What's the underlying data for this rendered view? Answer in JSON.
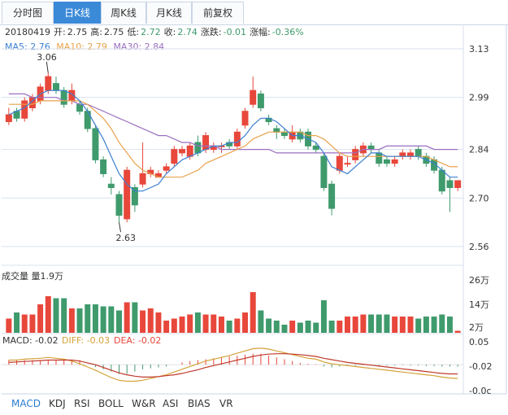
{
  "tabs": [
    {
      "label": "分时图",
      "active": false
    },
    {
      "label": "日K线",
      "active": true
    },
    {
      "label": "周K线",
      "active": false
    },
    {
      "label": "月K线",
      "active": false
    },
    {
      "label": "前复权",
      "active": false
    }
  ],
  "info": {
    "date": "20180419",
    "open_label": "开:",
    "open": "2.75",
    "high_label": "高:",
    "high": "2.75",
    "low_label": "低:",
    "low": "2.72",
    "close_label": "收:",
    "close": "2.74",
    "change_label": "涨跌:",
    "change": "-0.01",
    "pct_label": "涨幅:",
    "pct": "-0.36%"
  },
  "ma_legend": {
    "ma5": "MA5: 2.76",
    "ma10": "MA10: 2.79",
    "ma30": "MA30: 2.84"
  },
  "price_axis": [
    "3.13",
    "2.99",
    "2.84",
    "2.70",
    "2.56"
  ],
  "price_annotations": {
    "high": "3.06",
    "low": "2.63"
  },
  "volume_section": {
    "title": "成交量 量1.9万",
    "axis": [
      "26万",
      "14万",
      "2万"
    ]
  },
  "macd_section": {
    "macd": "MACD: -0.02",
    "diff": "DIFF: -0.03",
    "dea": "DEA: -0.02",
    "axis": [
      "0.05",
      "-0.02",
      "-0.0c"
    ]
  },
  "bottom_tabs": [
    {
      "label": "MACD",
      "active": true
    },
    {
      "label": "KDJ",
      "active": false
    },
    {
      "label": "RSI",
      "active": false
    },
    {
      "label": "BOLL",
      "active": false
    },
    {
      "label": "W&R",
      "active": false
    },
    {
      "label": "ASI",
      "active": false
    },
    {
      "label": "BIAS",
      "active": false
    },
    {
      "label": "VR",
      "active": false
    }
  ],
  "colors": {
    "up": "#e8473b",
    "down": "#3f9a6c",
    "ma5": "#3b7fd1",
    "ma10": "#e9a24b",
    "ma30": "#9b6fc1",
    "active_tab": "#3b8ad8",
    "grid": "#d9e2ee"
  },
  "chart_data": {
    "type": "candlestick",
    "price_ylim": [
      2.56,
      3.13
    ],
    "candles": [
      {
        "o": 2.92,
        "c": 2.94,
        "h": 2.96,
        "l": 2.91
      },
      {
        "o": 2.95,
        "c": 2.93,
        "h": 2.96,
        "l": 2.92
      },
      {
        "o": 2.93,
        "c": 2.98,
        "h": 2.99,
        "l": 2.92
      },
      {
        "o": 2.96,
        "c": 2.99,
        "h": 3.0,
        "l": 2.95
      },
      {
        "o": 2.98,
        "c": 3.02,
        "h": 3.03,
        "l": 2.97
      },
      {
        "o": 3.01,
        "c": 3.05,
        "h": 3.06,
        "l": 3.0
      },
      {
        "o": 3.03,
        "c": 3.01,
        "h": 3.05,
        "l": 3.0
      },
      {
        "o": 3.01,
        "c": 2.97,
        "h": 3.02,
        "l": 2.96
      },
      {
        "o": 2.98,
        "c": 3.01,
        "h": 3.03,
        "l": 2.97
      },
      {
        "o": 2.97,
        "c": 2.95,
        "h": 2.98,
        "l": 2.94
      },
      {
        "o": 2.95,
        "c": 2.9,
        "h": 2.96,
        "l": 2.89
      },
      {
        "o": 2.9,
        "c": 2.81,
        "h": 2.91,
        "l": 2.8
      },
      {
        "o": 2.81,
        "c": 2.77,
        "h": 2.82,
        "l": 2.76
      },
      {
        "o": 2.74,
        "c": 2.73,
        "h": 2.76,
        "l": 2.71
      },
      {
        "o": 2.71,
        "c": 2.65,
        "h": 2.72,
        "l": 2.63
      },
      {
        "o": 2.64,
        "c": 2.78,
        "h": 2.79,
        "l": 2.63
      },
      {
        "o": 2.73,
        "c": 2.68,
        "h": 2.74,
        "l": 2.66
      },
      {
        "o": 2.74,
        "c": 2.77,
        "h": 2.86,
        "l": 2.73
      },
      {
        "o": 2.77,
        "c": 2.78,
        "h": 2.79,
        "l": 2.76
      },
      {
        "o": 2.76,
        "c": 2.77,
        "h": 2.78,
        "l": 2.76
      },
      {
        "o": 2.78,
        "c": 2.79,
        "h": 2.8,
        "l": 2.77
      },
      {
        "o": 2.8,
        "c": 2.84,
        "h": 2.85,
        "l": 2.79
      },
      {
        "o": 2.83,
        "c": 2.84,
        "h": 2.85,
        "l": 2.82
      },
      {
        "o": 2.82,
        "c": 2.85,
        "h": 2.86,
        "l": 2.81
      },
      {
        "o": 2.86,
        "c": 2.83,
        "h": 2.88,
        "l": 2.82
      },
      {
        "o": 2.84,
        "c": 2.88,
        "h": 2.89,
        "l": 2.83
      },
      {
        "o": 2.84,
        "c": 2.85,
        "h": 2.86,
        "l": 2.83
      },
      {
        "o": 2.85,
        "c": 2.85,
        "h": 2.86,
        "l": 2.83
      },
      {
        "o": 2.86,
        "c": 2.85,
        "h": 2.87,
        "l": 2.84
      },
      {
        "o": 2.85,
        "c": 2.89,
        "h": 2.9,
        "l": 2.84
      },
      {
        "o": 2.91,
        "c": 2.95,
        "h": 2.96,
        "l": 2.9
      },
      {
        "o": 2.97,
        "c": 3.01,
        "h": 3.05,
        "l": 2.96
      },
      {
        "o": 3.0,
        "c": 2.96,
        "h": 3.01,
        "l": 2.95
      },
      {
        "o": 2.93,
        "c": 2.92,
        "h": 2.94,
        "l": 2.91
      },
      {
        "o": 2.9,
        "c": 2.89,
        "h": 2.91,
        "l": 2.87
      },
      {
        "o": 2.89,
        "c": 2.88,
        "h": 2.9,
        "l": 2.87
      },
      {
        "o": 2.87,
        "c": 2.89,
        "h": 2.91,
        "l": 2.86
      },
      {
        "o": 2.89,
        "c": 2.87,
        "h": 2.9,
        "l": 2.86
      },
      {
        "o": 2.89,
        "c": 2.85,
        "h": 2.9,
        "l": 2.84
      },
      {
        "o": 2.85,
        "c": 2.84,
        "h": 2.86,
        "l": 2.83
      },
      {
        "o": 2.82,
        "c": 2.73,
        "h": 2.83,
        "l": 2.72
      },
      {
        "o": 2.74,
        "c": 2.67,
        "h": 2.75,
        "l": 2.65
      },
      {
        "o": 2.78,
        "c": 2.82,
        "h": 2.83,
        "l": 2.77
      },
      {
        "o": 2.8,
        "c": 2.8,
        "h": 2.82,
        "l": 2.79
      },
      {
        "o": 2.81,
        "c": 2.84,
        "h": 2.85,
        "l": 2.8
      },
      {
        "o": 2.83,
        "c": 2.85,
        "h": 2.86,
        "l": 2.82
      },
      {
        "o": 2.85,
        "c": 2.84,
        "h": 2.86,
        "l": 2.83
      },
      {
        "o": 2.83,
        "c": 2.8,
        "h": 2.84,
        "l": 2.79
      },
      {
        "o": 2.81,
        "c": 2.8,
        "h": 2.82,
        "l": 2.79
      },
      {
        "o": 2.8,
        "c": 2.81,
        "h": 2.82,
        "l": 2.79
      },
      {
        "o": 2.82,
        "c": 2.83,
        "h": 2.84,
        "l": 2.81
      },
      {
        "o": 2.82,
        "c": 2.83,
        "h": 2.84,
        "l": 2.81
      },
      {
        "o": 2.84,
        "c": 2.82,
        "h": 2.85,
        "l": 2.81
      },
      {
        "o": 2.82,
        "c": 2.8,
        "h": 2.83,
        "l": 2.79
      },
      {
        "o": 2.81,
        "c": 2.78,
        "h": 2.82,
        "l": 2.77
      },
      {
        "o": 2.78,
        "c": 2.72,
        "h": 2.79,
        "l": 2.71
      },
      {
        "o": 2.75,
        "c": 2.73,
        "h": 2.76,
        "l": 2.66
      },
      {
        "o": 2.73,
        "c": 2.75,
        "h": 2.75,
        "l": 2.72
      }
    ],
    "ma5": [
      2.94,
      2.95,
      2.96,
      2.98,
      3.0,
      3.01,
      3.01,
      3.01,
      3.0,
      2.98,
      2.95,
      2.91,
      2.87,
      2.82,
      2.77,
      2.74,
      2.72,
      2.72,
      2.73,
      2.74,
      2.77,
      2.79,
      2.81,
      2.82,
      2.83,
      2.84,
      2.85,
      2.85,
      2.86,
      2.86,
      2.88,
      2.91,
      2.93,
      2.93,
      2.92,
      2.9,
      2.88,
      2.88,
      2.87,
      2.86,
      2.83,
      2.79,
      2.78,
      2.77,
      2.79,
      2.81,
      2.83,
      2.83,
      2.82,
      2.82,
      2.82,
      2.82,
      2.82,
      2.81,
      2.8,
      2.78,
      2.76,
      2.76
    ],
    "ma10": [
      2.97,
      2.97,
      2.97,
      2.97,
      2.98,
      2.98,
      2.98,
      2.98,
      2.98,
      2.98,
      2.97,
      2.95,
      2.93,
      2.9,
      2.86,
      2.83,
      2.8,
      2.78,
      2.77,
      2.76,
      2.76,
      2.76,
      2.76,
      2.77,
      2.78,
      2.8,
      2.81,
      2.82,
      2.83,
      2.84,
      2.85,
      2.87,
      2.88,
      2.89,
      2.89,
      2.89,
      2.89,
      2.89,
      2.88,
      2.88,
      2.87,
      2.85,
      2.83,
      2.82,
      2.82,
      2.82,
      2.82,
      2.82,
      2.82,
      2.82,
      2.82,
      2.82,
      2.82,
      2.82,
      2.81,
      2.8,
      2.79,
      2.79
    ],
    "ma30": [
      3.0,
      3.0,
      3.0,
      2.99,
      2.99,
      2.99,
      2.99,
      2.98,
      2.98,
      2.97,
      2.97,
      2.96,
      2.95,
      2.94,
      2.93,
      2.92,
      2.91,
      2.9,
      2.89,
      2.88,
      2.88,
      2.87,
      2.86,
      2.86,
      2.85,
      2.85,
      2.85,
      2.84,
      2.84,
      2.84,
      2.84,
      2.84,
      2.84,
      2.84,
      2.83,
      2.83,
      2.83,
      2.83,
      2.83,
      2.83,
      2.83,
      2.83,
      2.83,
      2.83,
      2.83,
      2.84,
      2.84,
      2.84,
      2.85,
      2.85,
      2.85,
      2.85,
      2.85,
      2.85,
      2.84,
      2.84,
      2.84,
      2.84
    ],
    "volume_max": 26,
    "volume": [
      7,
      10,
      9,
      9,
      14,
      18,
      17,
      17,
      12,
      12,
      14,
      14,
      13,
      13,
      11,
      15,
      15,
      11,
      12,
      10,
      6,
      7,
      8,
      9,
      10,
      9,
      9,
      8,
      6,
      7,
      10,
      20,
      11,
      7,
      6,
      4,
      6,
      5,
      6,
      5,
      16,
      6,
      6,
      8,
      8,
      9,
      9,
      9,
      9,
      8,
      8,
      8,
      7,
      8,
      8,
      9,
      8,
      1
    ],
    "macd_hist": [
      0.01,
      0.01,
      0.01,
      0.01,
      0.01,
      0.01,
      0.01,
      0.01,
      0.01,
      0.01,
      0.0,
      -0.005,
      -0.01,
      -0.015,
      -0.02,
      -0.02,
      -0.015,
      -0.01,
      -0.008,
      -0.006,
      -0.004,
      0.0,
      0.005,
      0.008,
      0.01,
      0.012,
      0.014,
      0.016,
      0.018,
      0.02,
      0.022,
      0.024,
      0.024,
      0.02,
      0.016,
      0.012,
      0.008,
      0.004,
      0.002,
      0.001,
      -0.004,
      -0.006,
      -0.004,
      -0.003,
      -0.002,
      -0.001,
      -0.002,
      -0.003,
      -0.002,
      -0.002,
      -0.001,
      -0.002,
      -0.002,
      -0.003,
      -0.003,
      -0.004,
      -0.004,
      -0.004
    ],
    "diff": [
      0.01,
      0.01,
      0.012,
      0.013,
      0.014,
      0.016,
      0.014,
      0.012,
      0.008,
      0.002,
      -0.005,
      -0.012,
      -0.02,
      -0.028,
      -0.034,
      -0.036,
      -0.036,
      -0.034,
      -0.03,
      -0.026,
      -0.022,
      -0.016,
      -0.01,
      -0.004,
      0.002,
      0.008,
      0.012,
      0.016,
      0.02,
      0.025,
      0.03,
      0.035,
      0.036,
      0.034,
      0.03,
      0.026,
      0.022,
      0.018,
      0.014,
      0.012,
      0.006,
      0.002,
      0.0,
      -0.002,
      -0.004,
      -0.006,
      -0.008,
      -0.01,
      -0.012,
      -0.014,
      -0.016,
      -0.018,
      -0.02,
      -0.022,
      -0.024,
      -0.027,
      -0.029,
      -0.03
    ],
    "dea": [
      0.005,
      0.006,
      0.007,
      0.008,
      0.009,
      0.01,
      0.01,
      0.01,
      0.01,
      0.008,
      0.004,
      0.0,
      -0.006,
      -0.012,
      -0.018,
      -0.022,
      -0.025,
      -0.027,
      -0.027,
      -0.026,
      -0.024,
      -0.022,
      -0.019,
      -0.015,
      -0.011,
      -0.006,
      -0.002,
      0.002,
      0.006,
      0.01,
      0.014,
      0.018,
      0.021,
      0.023,
      0.024,
      0.024,
      0.023,
      0.022,
      0.02,
      0.018,
      0.014,
      0.011,
      0.008,
      0.005,
      0.003,
      0.001,
      -0.001,
      -0.003,
      -0.005,
      -0.007,
      -0.009,
      -0.011,
      -0.013,
      -0.015,
      -0.017,
      -0.019,
      -0.02,
      -0.02
    ],
    "macd_ylim": [
      -0.06,
      0.05
    ]
  }
}
